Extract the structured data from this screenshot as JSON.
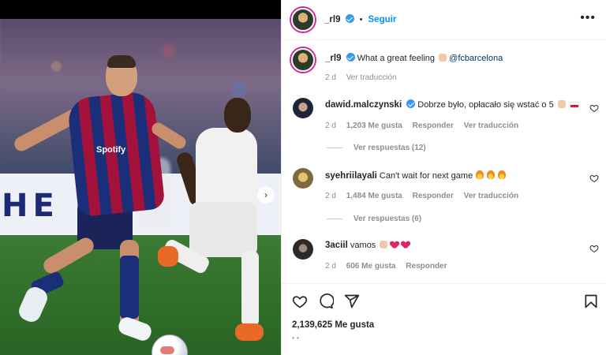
{
  "post": {
    "author": "_rl9",
    "follow_label": "Seguir",
    "caption_text": "What a great feeling",
    "caption_mention": "@fcbarcelona",
    "caption_time": "2 d",
    "caption_translate": "Ver traducción",
    "media_board_text": "HE N",
    "media_sponsor": "Spotify"
  },
  "comments": [
    {
      "username": "dawid.malczynski",
      "verified": true,
      "text": "Dobrze było, opłacało się wstać o 5",
      "time": "2 d",
      "likes": "1,203 Me gusta",
      "reply_label": "Responder",
      "translate_label": "Ver traducción",
      "view_replies": "Ver respuestas (12)"
    },
    {
      "username": "syehriilayali",
      "verified": false,
      "text": "Can't wait for next game",
      "time": "2 d",
      "likes": "1,484 Me gusta",
      "reply_label": "Responder",
      "translate_label": "Ver traducción",
      "view_replies": "Ver respuestas (6)"
    },
    {
      "username": "3aciil",
      "verified": false,
      "text": "vamos",
      "time": "2 d",
      "likes": "606 Me gusta",
      "reply_label": "Responder"
    }
  ],
  "footer": {
    "like_count": "2,139,625 Me gusta"
  },
  "icons": {
    "like": "heart-icon",
    "comment": "comment-icon",
    "share": "share-icon",
    "save": "bookmark-icon",
    "more": "more-options-icon",
    "next": "chevron-right-icon"
  },
  "colors": {
    "accent": "#0095f6",
    "verified": "#3897f0",
    "text": "#262626",
    "muted": "#8e8e8e",
    "mention": "#00376b"
  }
}
